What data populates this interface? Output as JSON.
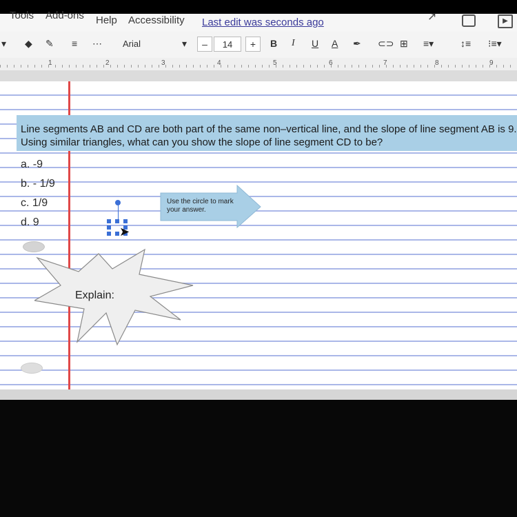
{
  "menu": {
    "tools": "Tools",
    "addons": "Add-ons",
    "help": "Help",
    "accessibility": "Accessibility",
    "last_edit": "Last edit was seconds ago"
  },
  "toolbar": {
    "font": "Arial",
    "font_size": "14",
    "minus": "–",
    "plus": "+",
    "bold": "B",
    "italic": "I",
    "underline": "U",
    "text_color": "A"
  },
  "ruler": {
    "numbers": [
      "1",
      "2",
      "3",
      "4",
      "5",
      "6",
      "7",
      "8",
      "9"
    ]
  },
  "question": {
    "text": "Line segments AB and CD are both part of the same non–vertical line, and the slope of line segment AB is 9. Using similar triangles, what can you show the slope of line segment CD to be?"
  },
  "options": {
    "a": "a.   -9",
    "b": "b.   - 1/9",
    "c": "c.   1/9",
    "d": "d.   9"
  },
  "callout": {
    "arrow_text": "Use the circle to mark your answer.",
    "explain_label": "Explain:"
  },
  "colors": {
    "question_band": "#a9cfe6",
    "margin_line": "#e04848",
    "rule_line": "#aab7e8",
    "selection": "#3b6fd6"
  }
}
